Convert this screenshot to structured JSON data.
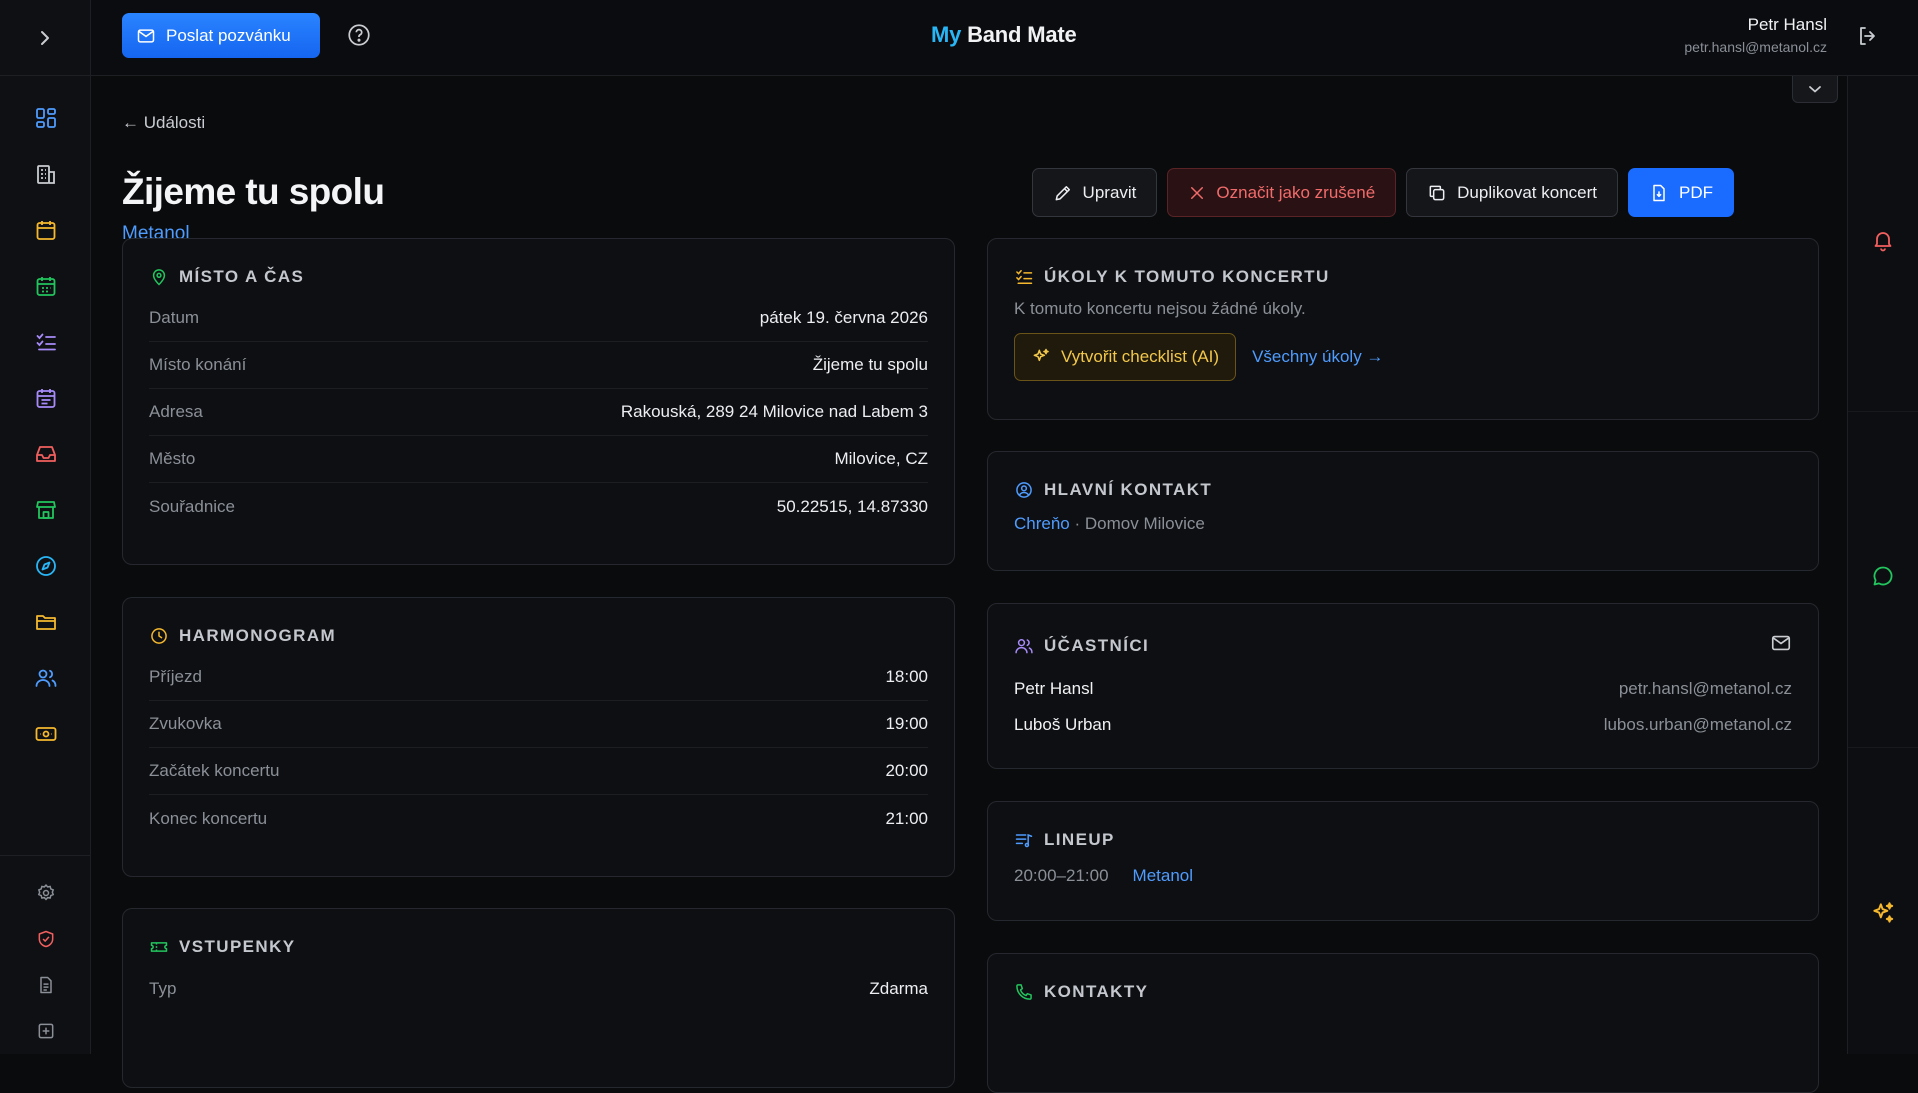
{
  "header": {
    "invite_label": "Poslat pozvánku",
    "brand_my": "My",
    "brand_rest": " Band Mate",
    "user_name": "Petr Hansl",
    "user_email": "petr.hansl@metanol.cz"
  },
  "rail": {
    "items": [
      {
        "icon": "dashboard-icon",
        "color": "#4f9cff"
      },
      {
        "icon": "building-icon",
        "color": "#c9ccd1"
      },
      {
        "icon": "calendar-icon",
        "color": "#f5b82e"
      },
      {
        "icon": "calendar-check-icon",
        "color": "#22c55e"
      },
      {
        "icon": "checklist-icon",
        "color": "#a78bfa"
      },
      {
        "icon": "calendar-list-icon",
        "color": "#a78bfa"
      },
      {
        "icon": "inbox-icon",
        "color": "#f25f5f"
      },
      {
        "icon": "store-icon",
        "color": "#22c55e"
      },
      {
        "icon": "compass-icon",
        "color": "#29b6f6"
      },
      {
        "icon": "folder-icon",
        "color": "#f5b82e"
      },
      {
        "icon": "users-icon",
        "color": "#4f9cff"
      },
      {
        "icon": "ticket-icon",
        "color": "#f5b82e"
      }
    ]
  },
  "page": {
    "back_label": "← Události",
    "title": "Žijeme tu spolu",
    "subtitle": "Metanol",
    "actions": {
      "edit": "Upravit",
      "cancel": "Označit jako zrušené",
      "duplicate": "Duplikovat koncert",
      "pdf": "PDF"
    }
  },
  "place": {
    "heading": "MÍSTO A ČAS",
    "rows": [
      {
        "k": "Datum",
        "v": "pátek 19. června 2026"
      },
      {
        "k": "Místo konání",
        "v": "Žijeme tu spolu"
      },
      {
        "k": "Adresa",
        "v": "Rakouská, 289 24 Milovice nad Labem 3"
      },
      {
        "k": "Město",
        "v": "Milovice, CZ"
      },
      {
        "k": "Souřadnice",
        "v": "50.22515, 14.87330"
      }
    ]
  },
  "schedule": {
    "heading": "HARMONOGRAM",
    "rows": [
      {
        "k": "Příjezd",
        "v": "18:00"
      },
      {
        "k": "Zvukovka",
        "v": "19:00"
      },
      {
        "k": "Začátek koncertu",
        "v": "20:00"
      },
      {
        "k": "Konec koncertu",
        "v": "21:00"
      }
    ]
  },
  "tickets": {
    "heading": "VSTUPENKY",
    "rows": [
      {
        "k": "Typ",
        "v": "Zdarma"
      }
    ]
  },
  "tasks": {
    "heading": "ÚKOLY K TOMUTO KONCERTU",
    "empty": "K tomuto koncertu nejsou žádné úkoly.",
    "ai_button": "Vytvořit checklist (AI)",
    "all_link": "Všechny úkoly →"
  },
  "contact": {
    "heading": "HLAVNÍ KONTAKT",
    "name": "Chreňo",
    "sep": " · ",
    "org": "Domov Milovice"
  },
  "participants": {
    "heading": "ÚČASTNÍCI",
    "list": [
      {
        "name": "Petr Hansl",
        "email": "petr.hansl@metanol.cz"
      },
      {
        "name": "Luboš Urban",
        "email": "lubos.urban@metanol.cz"
      }
    ]
  },
  "lineup": {
    "heading": "LINEUP",
    "time": "20:00–21:00",
    "band": "Metanol"
  },
  "contacts": {
    "heading": "KONTAKTY"
  }
}
